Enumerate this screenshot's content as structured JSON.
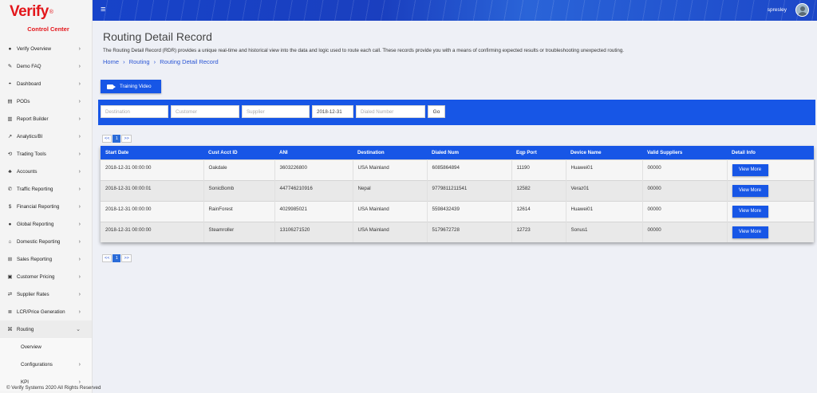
{
  "brand": {
    "name": "Verify",
    "reg": "®",
    "subtitle": "Control Center"
  },
  "header": {
    "username": "spresley"
  },
  "sidebar": {
    "items": [
      {
        "icon": "●",
        "label": "Verify Overview",
        "chev": "›"
      },
      {
        "icon": "✎",
        "label": "Demo FAQ",
        "chev": "›"
      },
      {
        "icon": "◓",
        "label": "Dashboard",
        "chev": "›"
      },
      {
        "icon": "▤",
        "label": "PODs",
        "chev": "›"
      },
      {
        "icon": "▥",
        "label": "Report Builder",
        "chev": "›"
      },
      {
        "icon": "↗",
        "label": "Analytics/BI",
        "chev": "›"
      },
      {
        "icon": "⟲",
        "label": "Trading Tools",
        "chev": "›"
      },
      {
        "icon": "♣",
        "label": "Accounts",
        "chev": "›"
      },
      {
        "icon": "✆",
        "label": "Traffic Reporting",
        "chev": "›"
      },
      {
        "icon": "$",
        "label": "Financial Reporting",
        "chev": "›"
      },
      {
        "icon": "●",
        "label": "Global Reporting",
        "chev": "›"
      },
      {
        "icon": "⌂",
        "label": "Domestic Reporting",
        "chev": "›"
      },
      {
        "icon": "⊞",
        "label": "Sales Reporting",
        "chev": "›"
      },
      {
        "icon": "▣",
        "label": "Customer Pricing",
        "chev": "›"
      },
      {
        "icon": "⇄",
        "label": "Supplier Rates",
        "chev": "›"
      },
      {
        "icon": "≣",
        "label": "LCR/Price Generation",
        "chev": "›"
      }
    ],
    "routing": {
      "icon": "⌘",
      "label": "Routing",
      "chev": "⌄"
    },
    "sub_items": [
      {
        "label": "Overview",
        "chev": ""
      },
      {
        "label": "Configurations",
        "chev": "›"
      },
      {
        "label": "KPI",
        "chev": "›"
      }
    ]
  },
  "page": {
    "title": "Routing Detail Record",
    "description": "The Routing Detail Record (RDR) provides a unique real-time and historical view into the data and logic used to route each call. These records provide you with a means of confirming expected results or troubleshooting unexpected routing.",
    "breadcrumb": [
      "Home",
      "Routing",
      "Routing Detail Record"
    ],
    "breadcrumb_sep": "›",
    "training_label": "Training Video"
  },
  "filters": {
    "destination_placeholder": "Destination",
    "customer_placeholder": "Customer",
    "supplier_placeholder": "Supplier",
    "date_value": "2018-12-31",
    "dialed_placeholder": "Dialed Number",
    "go_label": "Go"
  },
  "pager": {
    "prev": "<<",
    "page": "1",
    "next": ">>"
  },
  "table": {
    "headers": [
      "Start Date",
      "Cust Acct ID",
      "ANI",
      "Destination",
      "Dialed Num",
      "Eqp Port",
      "Device Name",
      "Valid Suppliers",
      "Detail Info"
    ],
    "rows": [
      [
        "2018-12-31 00:00:00",
        "Oakdale",
        "3603226800",
        "USA Mainland",
        "6085864894",
        "11190",
        "Huawei01",
        "00000"
      ],
      [
        "2018-12-31 00:00:01",
        "SonicBomb",
        "447746210916",
        "Nepal",
        "9779811211541",
        "12582",
        "Veraz01",
        "00000"
      ],
      [
        "2018-12-31 00:00:00",
        "RainForest",
        "4029985021",
        "USA Mainland",
        "5598432439",
        "12614",
        "Huawei01",
        "00000"
      ],
      [
        "2018-12-31 00:00:00",
        "Steamroller",
        "13106271520",
        "USA Mainland",
        "5179672728",
        "12723",
        "Sonus1",
        "00000"
      ]
    ],
    "view_label": "View More"
  },
  "footer": "© Verify Systems 2020 All Rights Reserved"
}
